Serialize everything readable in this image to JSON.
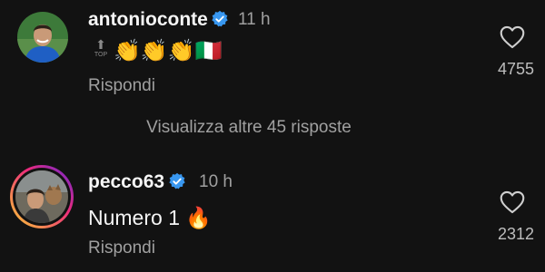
{
  "comments": [
    {
      "username": "antonioconte",
      "time": "11 h",
      "text_prefix": "⬆",
      "text_prefix_caption": "TOP",
      "text": "👏👏👏🇮🇹",
      "reply_label": "Rispondi",
      "likes": "4755",
      "verified": true,
      "avatar_icon": "profile-photo-icon"
    },
    {
      "username": "pecco63",
      "time": "10 h",
      "text": "Numero 1 🔥",
      "reply_label": "Rispondi",
      "likes": "2312",
      "verified": true,
      "avatar_icon": "profile-photo-icon"
    }
  ],
  "more_replies_label": "Visualizza altre 45 risposte",
  "colors": {
    "background": "#121212",
    "text_primary": "#f5f5f5",
    "text_secondary": "#a0a0a0",
    "verified_blue": "#3897f0",
    "story_ring_start": "#f9ce34",
    "story_ring_end": "#ee2a7b"
  }
}
